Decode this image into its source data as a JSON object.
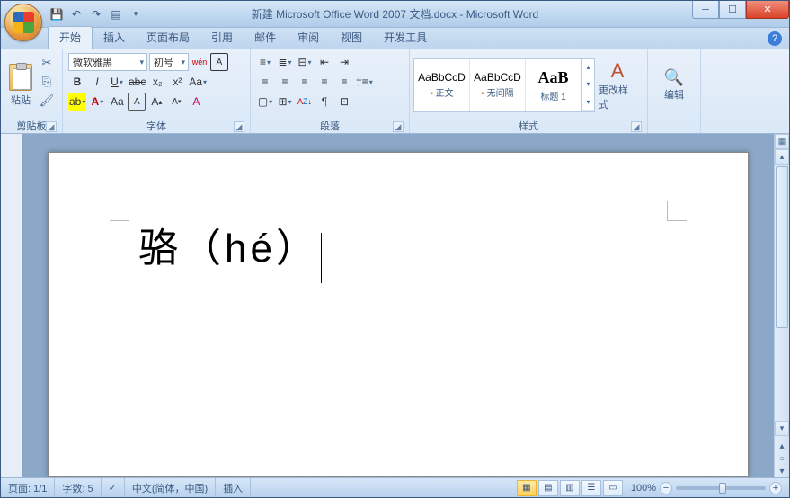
{
  "title": "新建 Microsoft Office Word 2007 文档.docx - Microsoft Word",
  "tabs": {
    "home": "开始",
    "insert": "插入",
    "layout": "页面布局",
    "references": "引用",
    "mailings": "邮件",
    "review": "审阅",
    "view": "视图",
    "developer": "开发工具"
  },
  "ribbon": {
    "clipboard": {
      "label": "剪贴板",
      "paste": "粘贴"
    },
    "font": {
      "label": "字体",
      "name": "微软雅黑",
      "size": "初号",
      "pinyin_guide": "wén",
      "enclose": "A"
    },
    "paragraph": {
      "label": "段落"
    },
    "styles": {
      "label": "样式",
      "items": [
        {
          "preview": "AaBbCcD",
          "name": "正文",
          "sel": true
        },
        {
          "preview": "AaBbCcD",
          "name": "无间隔",
          "sel": true
        },
        {
          "preview": "AaB",
          "name": "标题 1",
          "sel": false
        }
      ],
      "change": "更改样式"
    },
    "editing": {
      "label": "编辑"
    }
  },
  "document": {
    "text": "骆（hé）"
  },
  "status": {
    "page": "页面: 1/1",
    "words": "字数: 5",
    "language": "中文(简体，中国)",
    "mode": "插入",
    "zoom": "100%"
  }
}
